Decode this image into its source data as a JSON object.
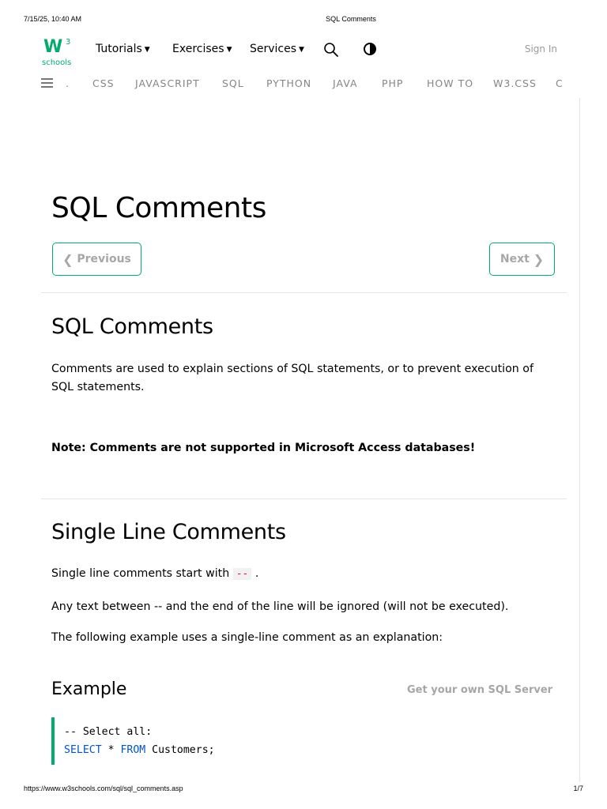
{
  "print": {
    "datetime": "7/15/25, 10:40 AM",
    "title": "SQL Comments",
    "url": "https://www.w3schools.com/sql/sql_comments.asp",
    "page": "1/7"
  },
  "logo": {
    "mark": "W",
    "superscript": "3",
    "subtitle": "schools",
    "color": "#04aa6d"
  },
  "topnav": {
    "tutorials": "Tutorials",
    "exercises": "Exercises",
    "services": "Services",
    "search_icon": "search-icon",
    "theme_icon": "contrast-icon",
    "signin": "Sign In"
  },
  "subnav": {
    "items": [
      ".",
      "CSS",
      "JAVASCRIPT",
      "SQL",
      "PYTHON",
      "JAVA",
      "PHP",
      "HOW TO",
      "W3.CSS",
      "C"
    ]
  },
  "main": {
    "title": "SQL Comments",
    "prev_label": "Previous",
    "next_label": "Next",
    "section1": {
      "heading": "SQL Comments",
      "p1": "Comments are used to explain sections of SQL statements, or to prevent execution of SQL statements.",
      "note": "Note: Comments are not supported in Microsoft Access databases!"
    },
    "section2": {
      "heading": "Single Line Comments",
      "p1_before": "Single line comments start with",
      "p1_code": "--",
      "p1_after": ".",
      "p2": "Any text between -- and the end of the line will be ignored (will not be executed).",
      "p3": "The following example uses a single-line comment as an explanation:"
    },
    "example": {
      "heading": "Example",
      "get_server": "Get your own SQL Server",
      "line1": "-- Select all:",
      "kw_select": "SELECT",
      "star": " * ",
      "kw_from": "FROM",
      "rest": " Customers;"
    }
  },
  "colors": {
    "accent": "#04aa6d",
    "keyword": "#0054d1",
    "inline_code": "#dc143c"
  }
}
